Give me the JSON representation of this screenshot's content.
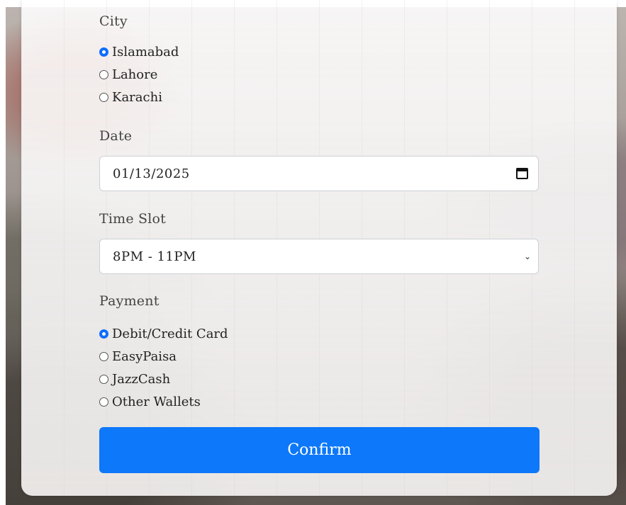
{
  "form": {
    "city": {
      "label": "City",
      "options": [
        {
          "label": "Islamabad",
          "checked": true
        },
        {
          "label": "Lahore",
          "checked": false
        },
        {
          "label": "Karachi",
          "checked": false
        }
      ]
    },
    "date": {
      "label": "Date",
      "value": "01/13/2025",
      "icon": "calendar-icon"
    },
    "time_slot": {
      "label": "Time Slot",
      "value": "8PM - 11PM",
      "icon": "chevron-down-icon"
    },
    "payment": {
      "label": "Payment",
      "options": [
        {
          "label": "Debit/Credit Card",
          "checked": true
        },
        {
          "label": "EasyPaisa",
          "checked": false
        },
        {
          "label": "JazzCash",
          "checked": false
        },
        {
          "label": "Other Wallets",
          "checked": false
        }
      ]
    },
    "confirm_label": "Confirm"
  },
  "colors": {
    "accent": "#0d78f9",
    "radio_checked": "#0d6efd"
  }
}
